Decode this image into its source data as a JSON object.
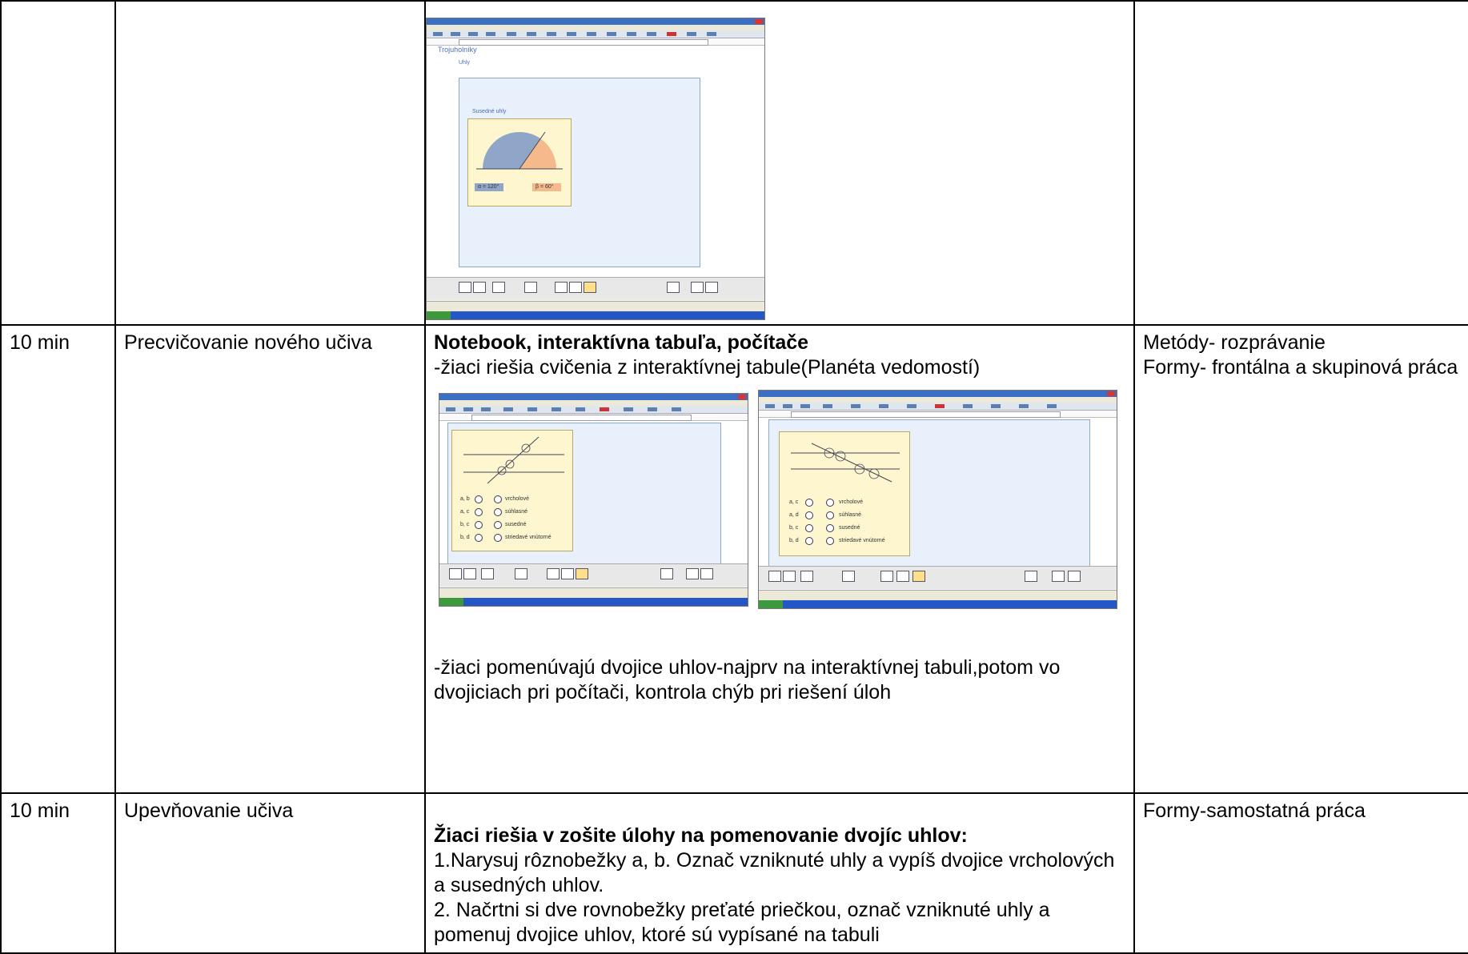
{
  "rows": [
    {
      "time": "",
      "phase": "",
      "content_heading": "",
      "content_lines": [],
      "methods_lines": []
    },
    {
      "time": "10 min",
      "phase": "Precvičovanie nového učiva",
      "content_heading": "Notebook, interaktívna tabuľa, počítače",
      "content_intro": "-žiaci riešia  cvičenia z  interaktívnej tabule(Planéta vedomostí)",
      "content_after": "-žiaci pomenúvajú dvojice uhlov-najprv na interaktívnej tabuli,potom vo dvojiciach pri počítači, kontrola  chýb pri riešení úloh",
      "methods_lines": [
        "Metódy- rozprávanie",
        "Formy- frontálna a skupinová práca"
      ]
    },
    {
      "time": "10 min",
      "phase": "Upevňovanie učiva",
      "content_heading": "Žiaci riešia v zošite úlohy na pomenovanie dvojíc uhlov:",
      "content_lines": [
        "1.Narysuj rôznobežky a, b. Označ vzniknuté uhly a vypíš dvojice vrcholových a susedných uhlov.",
        "2. Načrtni si dve rovnobežky preťaté priečkou, označ vzniknuté uhly a pomenuj dvojice uhlov, ktoré sú vypísané na tabuli"
      ],
      "methods_lines": [
        "Formy-samostatná práca"
      ]
    }
  ],
  "screenshots": {
    "shot1": {
      "breadcrumb": "Trojuholníky",
      "section": "Uhly",
      "title": "Susedné uhly",
      "angle_alpha": "α = 120°",
      "angle_beta": "β = 60°"
    },
    "shot2": {
      "options_left": [
        "a, b",
        "a, c",
        "b, c",
        "b, d"
      ],
      "options_right": [
        "vrcholové",
        "súhlasné",
        "susedné",
        "striedavé vnútorné"
      ]
    },
    "shot3": {
      "options_left": [
        "a, c",
        "a, d",
        "b, c",
        "b, d"
      ],
      "options_right": [
        "vrcholové",
        "súhlasné",
        "susedné",
        "striedavé vnútorné"
      ]
    }
  }
}
